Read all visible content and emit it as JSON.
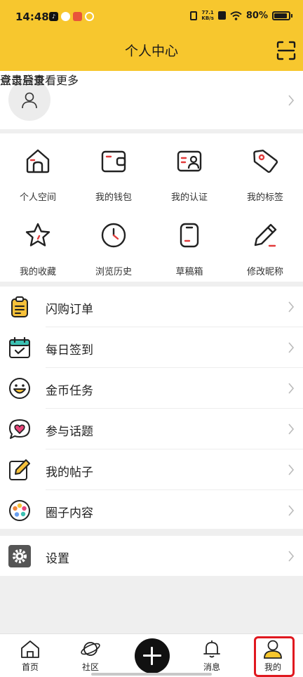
{
  "status": {
    "time": "14:48",
    "net_speed_top": "77.1",
    "net_speed_bottom": "KB/s",
    "battery": "80%",
    "battery_level": 0.8
  },
  "header": {
    "title": "个人中心"
  },
  "login": {
    "title": "点击登录",
    "subtitle": "登录后查看更多"
  },
  "grid": [
    {
      "label": "个人空间",
      "icon": "home-icon"
    },
    {
      "label": "我的钱包",
      "icon": "wallet-icon"
    },
    {
      "label": "我的认证",
      "icon": "id-card-icon"
    },
    {
      "label": "我的标签",
      "icon": "tag-icon"
    },
    {
      "label": "我的收藏",
      "icon": "star-icon"
    },
    {
      "label": "浏览历史",
      "icon": "clock-icon"
    },
    {
      "label": "草稿箱",
      "icon": "draft-icon"
    },
    {
      "label": "修改昵称",
      "icon": "pencil-icon"
    }
  ],
  "menu": [
    {
      "label": "闪购订单",
      "icon": "clipboard-icon"
    },
    {
      "label": "每日签到",
      "icon": "calendar-check-icon"
    },
    {
      "label": "金币任务",
      "icon": "smile-icon"
    },
    {
      "label": "参与话题",
      "icon": "heart-bubble-icon"
    },
    {
      "label": "我的帖子",
      "icon": "edit-post-icon"
    },
    {
      "label": "圈子内容",
      "icon": "circle-icon"
    }
  ],
  "settings": {
    "label": "设置",
    "icon": "gear-icon"
  },
  "tabs": [
    {
      "label": "首页",
      "icon": "home-tab-icon"
    },
    {
      "label": "社区",
      "icon": "planet-icon"
    },
    {
      "label": "消息",
      "icon": "bell-icon"
    },
    {
      "label": "我的",
      "icon": "user-tab-icon"
    }
  ],
  "colors": {
    "accent": "#f7c72e",
    "red_mark": "#e23b3b",
    "highlight": "#e0181f"
  }
}
